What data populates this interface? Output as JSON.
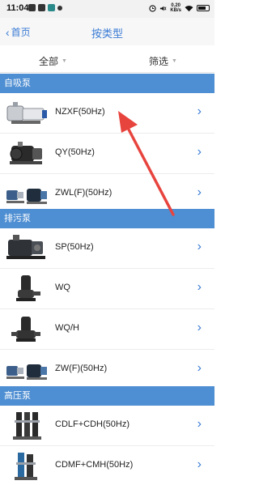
{
  "status_bar": {
    "time": "11:04",
    "speed_top": "0.20",
    "speed_bottom": "KB/s"
  },
  "nav": {
    "back_label": "首页",
    "title": "按类型"
  },
  "filters": {
    "all_label": "全部",
    "screen_label": "筛选"
  },
  "sections": [
    {
      "title": "自吸泵"
    },
    {
      "title": "排污泵"
    },
    {
      "title": "高压泵"
    }
  ],
  "items": [
    {
      "label": "NZXF(50Hz)",
      "icon": "self-priming-pump"
    },
    {
      "label": "QY(50Hz)",
      "icon": "pump-motor"
    },
    {
      "label": "ZWL(F)(50Hz)",
      "icon": "pump-pair"
    },
    {
      "label": "SP(50Hz)",
      "icon": "pump-skid"
    },
    {
      "label": "WQ",
      "icon": "submersible-pump"
    },
    {
      "label": "WQ/H",
      "icon": "submersible-pump"
    },
    {
      "label": "ZW(F)(50Hz)",
      "icon": "pump-pair"
    },
    {
      "label": "CDLF+CDH(50Hz)",
      "icon": "vertical-multistage-pump"
    },
    {
      "label": "CDMF+CMH(50Hz)",
      "icon": "vertical-multistage-pump"
    }
  ],
  "colors": {
    "section_bg": "#4e8ed2",
    "accent": "#3a7bd5",
    "annotation": "#e8443e"
  }
}
